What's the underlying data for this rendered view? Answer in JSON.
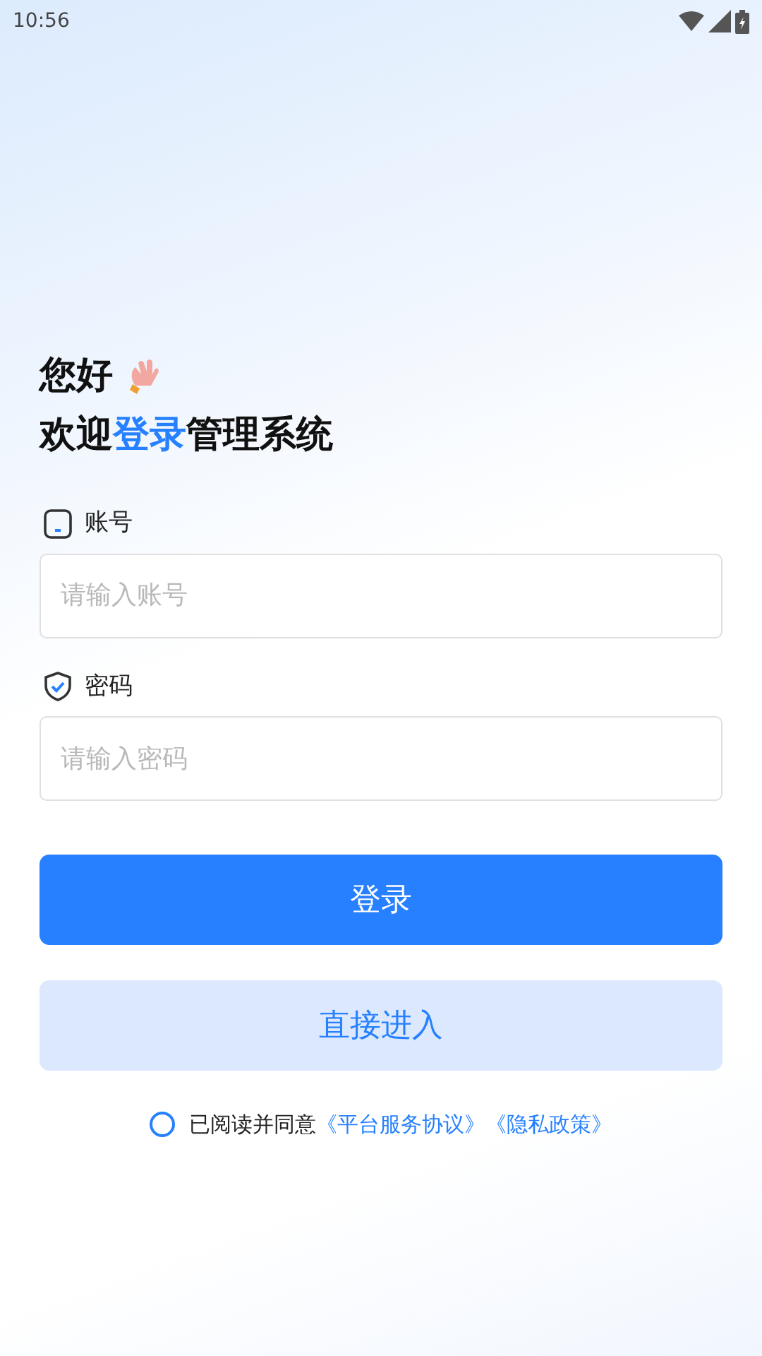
{
  "status_bar": {
    "time": "10:56"
  },
  "greeting": "您好",
  "title_parts": [
    {
      "text": "欢迎",
      "highlight": false
    },
    {
      "text": "登录",
      "highlight": true
    },
    {
      "text": "管理系统",
      "highlight": false
    }
  ],
  "fields": [
    {
      "kind": "account",
      "label": "账号",
      "placeholder": "请输入账号"
    },
    {
      "kind": "password",
      "label": "密码",
      "placeholder": "请输入密码"
    }
  ],
  "buttons": [
    {
      "kind": "primary",
      "label": "登录"
    },
    {
      "kind": "secondary",
      "label": "直接进入"
    }
  ],
  "agreement": {
    "checked": false,
    "text": "已阅读并同意",
    "links": [
      "《平台服务协议》",
      "《隐私政策》"
    ]
  }
}
